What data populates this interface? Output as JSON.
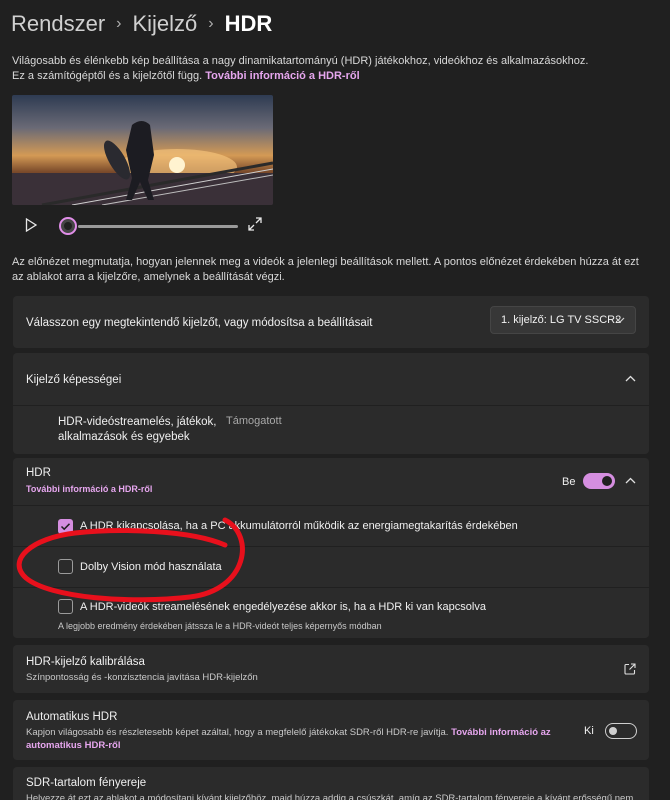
{
  "breadcrumb": [
    "Rendszer",
    "Kijelző",
    "HDR"
  ],
  "intro": {
    "text": "Világosabb és élénkebb kép beállítása a nagy dinamikatartományú (HDR) játékokhoz, videókhoz és alkalmazásokhoz. Ez a számítógéptől és a kijelzőtől függ.",
    "link": "További információ a HDR-ről"
  },
  "video": {
    "progress": 0.0
  },
  "preview_description": "Az előnézet megmutatja, hogyan jelennek meg a videók a jelenlegi beállítások mellett. A pontos előnézet érdekében húzza át ezt az ablakot arra a kijelzőre, amelynek a beállítását végzi.",
  "display_select": {
    "label": "Válasszon egy megtekintendő kijelzőt, vagy módosítsa a beállításait",
    "value": "1. kijelző: LG TV SSCR2"
  },
  "capabilities": {
    "header": "Kijelző képességei",
    "row_label": "HDR-videóstreamelés, játékok, alkalmazások és egyebek",
    "row_value": "Támogatott"
  },
  "hdr": {
    "label": "HDR",
    "link": "További információ a HDR-ről",
    "state": "Be",
    "on": true
  },
  "hdr_options": [
    {
      "label": "A HDR kikapcsolása, ha a PC akkumulátorról működik az energiamegtakarítás érdekében",
      "checked": true
    },
    {
      "label": "Dolby Vision mód használata",
      "checked": false
    },
    {
      "label": "A HDR-videók streamelésének engedélyezése akkor is, ha a HDR ki van kapcsolva",
      "checked": false,
      "note": "A legjobb eredmény érdekében játssza le a HDR-videót teljes képernyős módban"
    }
  ],
  "calibration": {
    "label": "HDR-kijelző kalibrálása",
    "sublabel": "Színpontosság és -konzisztencia javítása HDR-kijelzőn"
  },
  "auto_hdr": {
    "label": "Automatikus HDR",
    "sublabel": "Kapjon világosabb és részletesebb képet azáltal, hogy a megfelelő játékokat SDR-ről HDR-re javítja.",
    "link": "További információ az automatikus HDR-ről",
    "state": "Ki",
    "on": false
  },
  "sdr_brightness": {
    "label": "SDR-tartalom fényereje",
    "sublabel": "Helyezze át ezt az ablakot a módosítani kívánt kijelzőhöz, majd húzza addig a csúszkát, amíg az SDR-tartalom fényereje a kívánt erősségű nem"
  },
  "colors": {
    "accent": "#d58ee0",
    "link": "#e6a6ee",
    "annotation": "#e8101c",
    "background": "#202020",
    "card": "#2b2b2b"
  }
}
